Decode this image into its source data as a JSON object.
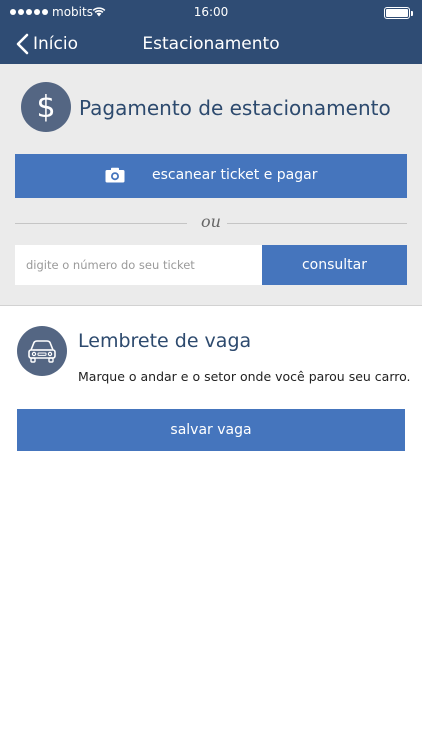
{
  "status_bar": {
    "carrier": "mobits",
    "time": "16:00"
  },
  "nav": {
    "back_label": "Início",
    "title": "Estacionamento"
  },
  "payment": {
    "icon": "dollar-icon",
    "icon_glyph": "$",
    "title": "Pagamento de estacionamento",
    "scan_button_label": "escanear ticket e pagar",
    "or_label": "ou",
    "ticket_placeholder": "digite o número do seu ticket",
    "ticket_value": "",
    "consult_button_label": "consultar"
  },
  "reminder": {
    "icon": "car-icon",
    "title": "Lembrete de vaga",
    "description": "Marque o andar e o setor onde você parou seu carro.",
    "save_button_label": "salvar vaga"
  },
  "colors": {
    "header_bg": "#2f4c74",
    "accent": "#4575bd",
    "icon_circle": "#546683",
    "section_bg": "#ebebeb",
    "title_text": "#2d4a6e"
  }
}
